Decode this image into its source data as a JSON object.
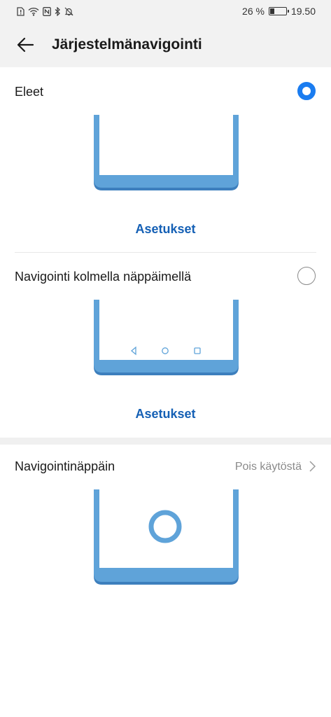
{
  "status_bar": {
    "battery_percent_text": "26 %",
    "battery_level": 0.26,
    "time": "19.50",
    "icons": [
      "sim-alert-icon",
      "wifi-icon",
      "nfc-icon",
      "bluetooth-icon",
      "do-not-disturb-icon"
    ]
  },
  "header": {
    "back_icon": "arrow-left-icon",
    "title": "Järjestelmänavigointi"
  },
  "options": [
    {
      "label": "Eleet",
      "selected": true,
      "settings_label": "Asetukset",
      "illustration": "gesture-navigation"
    },
    {
      "label": "Navigointi kolmella näppäimellä",
      "selected": false,
      "settings_label": "Asetukset",
      "illustration": "three-key-navigation"
    }
  ],
  "navigation_dock": {
    "label": "Navigointinäppäin",
    "value": "Pois käytöstä",
    "illustration": "navigation-dock"
  },
  "colors": {
    "accent": "#1a7cf0",
    "link": "#1560b5",
    "illustration_blue": "#5fa3d9",
    "illustration_shadow": "#3d7fbd",
    "header_bg": "#f2f2f2"
  }
}
